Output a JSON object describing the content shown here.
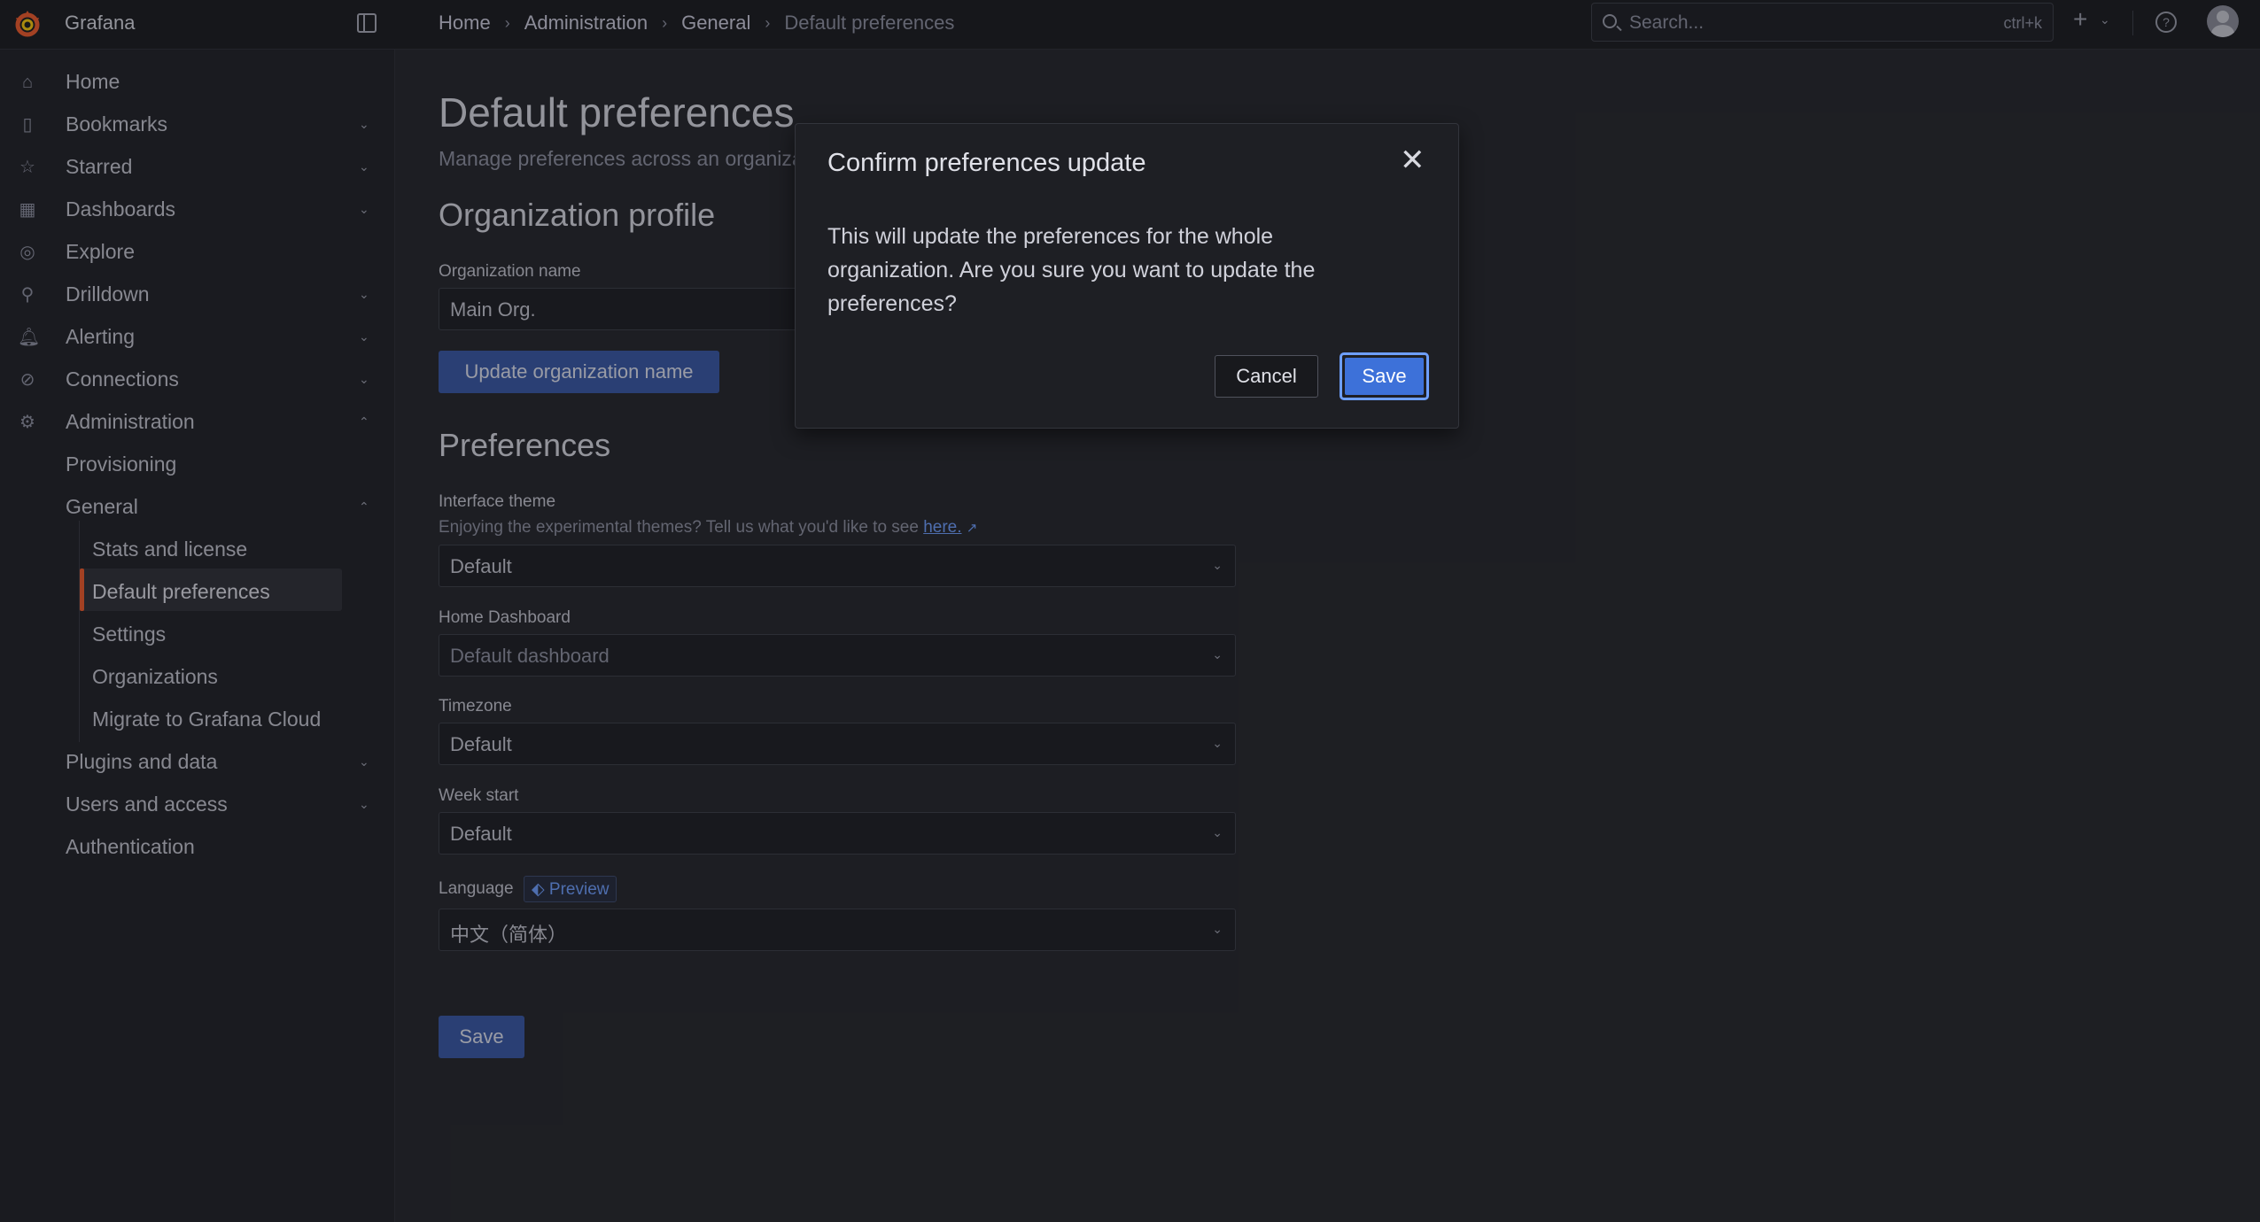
{
  "app": {
    "brand": "Grafana"
  },
  "breadcrumbs": [
    "Home",
    "Administration",
    "General",
    "Default preferences"
  ],
  "search": {
    "placeholder": "Search...",
    "shortcut": "ctrl+k"
  },
  "sidebar": {
    "items": [
      {
        "label": "Home",
        "icon": "home-icon"
      },
      {
        "label": "Bookmarks",
        "icon": "bookmark-icon"
      },
      {
        "label": "Starred",
        "icon": "star-icon"
      },
      {
        "label": "Dashboards",
        "icon": "apps-icon"
      },
      {
        "label": "Explore",
        "icon": "compass-icon"
      },
      {
        "label": "Drilldown",
        "icon": "drilldown-icon"
      },
      {
        "label": "Alerting",
        "icon": "bell-icon"
      },
      {
        "label": "Connections",
        "icon": "link-icon"
      },
      {
        "label": "Administration",
        "icon": "gear-icon"
      }
    ],
    "admin_sub": [
      "Provisioning",
      "General",
      "Plugins and data",
      "Users and access",
      "Authentication"
    ],
    "general_sub": [
      "Stats and license",
      "Default preferences",
      "Settings",
      "Organizations",
      "Migrate to Grafana Cloud"
    ]
  },
  "page": {
    "title": "Default preferences",
    "subtitle": "Manage preferences across an organiza",
    "org_section": "Organization profile",
    "org_name_label": "Organization name",
    "org_name_value": "Main Org.",
    "update_org_button": "Update organization name",
    "prefs_section": "Preferences",
    "theme_label": "Interface theme",
    "theme_desc": "Enjoying the experimental themes? Tell us what you'd like to see ",
    "theme_link": "here.",
    "theme_value": "Default",
    "home_dash_label": "Home Dashboard",
    "home_dash_value": "Default dashboard",
    "timezone_label": "Timezone",
    "timezone_value": "Default",
    "week_label": "Week start",
    "week_value": "Default",
    "language_label": "Language",
    "language_badge": "Preview",
    "language_value": "中文（简体）",
    "save_button": "Save"
  },
  "modal": {
    "title": "Confirm preferences update",
    "body": "This will update the preferences for the whole organization. Are you sure you want to update the preferences?",
    "cancel": "Cancel",
    "save": "Save"
  },
  "colors": {
    "accent": "#3d71d9",
    "active_indicator": "#f05a28",
    "link": "#6e9fff"
  }
}
